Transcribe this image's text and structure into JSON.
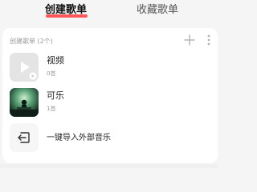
{
  "tabs": {
    "created": "创建歌单",
    "favorite": "收藏歌单"
  },
  "section": {
    "header": "创建歌单 (2个)"
  },
  "playlists": [
    {
      "title": "视频",
      "count": "0首",
      "cover_icon": "play-icon"
    },
    {
      "title": "可乐",
      "count": "1首",
      "cover_icon": "photo-cover"
    }
  ],
  "import": {
    "label": "一键导入外部音乐",
    "icon": "import-icon"
  },
  "colors": {
    "accent": "#ff3a3a",
    "background": "#f5f5f5",
    "card": "#ffffff"
  }
}
